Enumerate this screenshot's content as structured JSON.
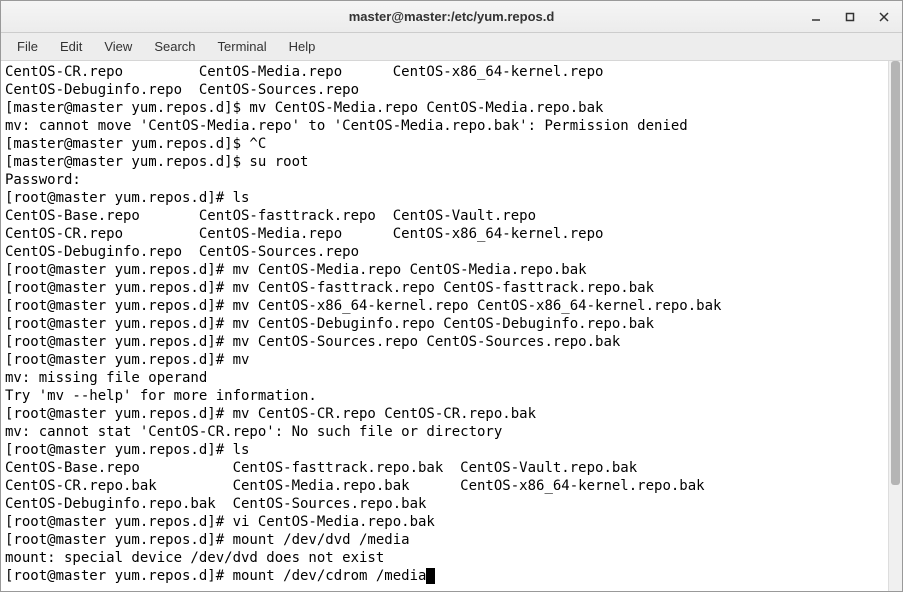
{
  "window": {
    "title": "master@master:/etc/yum.repos.d"
  },
  "menu": {
    "file": "File",
    "edit": "Edit",
    "view": "View",
    "search": "Search",
    "terminal": "Terminal",
    "help": "Help"
  },
  "terminal": {
    "lines": [
      "CentOS-CR.repo         CentOS-Media.repo      CentOS-x86_64-kernel.repo",
      "CentOS-Debuginfo.repo  CentOS-Sources.repo",
      "[master@master yum.repos.d]$ mv CentOS-Media.repo CentOS-Media.repo.bak",
      "mv: cannot move 'CentOS-Media.repo' to 'CentOS-Media.repo.bak': Permission denied",
      "[master@master yum.repos.d]$ ^C",
      "[master@master yum.repos.d]$ su root",
      "Password: ",
      "[root@master yum.repos.d]# ls",
      "CentOS-Base.repo       CentOS-fasttrack.repo  CentOS-Vault.repo",
      "CentOS-CR.repo         CentOS-Media.repo      CentOS-x86_64-kernel.repo",
      "CentOS-Debuginfo.repo  CentOS-Sources.repo",
      "[root@master yum.repos.d]# mv CentOS-Media.repo CentOS-Media.repo.bak",
      "[root@master yum.repos.d]# mv CentOS-fasttrack.repo CentOS-fasttrack.repo.bak",
      "[root@master yum.repos.d]# mv CentOS-x86_64-kernel.repo CentOS-x86_64-kernel.repo.bak",
      "[root@master yum.repos.d]# mv CentOS-Debuginfo.repo CentOS-Debuginfo.repo.bak",
      "[root@master yum.repos.d]# mv CentOS-Sources.repo CentOS-Sources.repo.bak",
      "[root@master yum.repos.d]# mv",
      "mv: missing file operand",
      "Try 'mv --help' for more information.",
      "[root@master yum.repos.d]# mv CentOS-CR.repo CentOS-CR.repo.bak",
      "mv: cannot stat 'CentOS-CR.repo': No such file or directory",
      "[root@master yum.repos.d]# ls",
      "CentOS-Base.repo           CentOS-fasttrack.repo.bak  CentOS-Vault.repo.bak",
      "CentOS-CR.repo.bak         CentOS-Media.repo.bak      CentOS-x86_64-kernel.repo.bak",
      "CentOS-Debuginfo.repo.bak  CentOS-Sources.repo.bak",
      "[root@master yum.repos.d]# vi CentOS-Media.repo.bak",
      "[root@master yum.repos.d]# mount /dev/dvd /media",
      "mount: special device /dev/dvd does not exist",
      "[root@master yum.repos.d]# mount /dev/cdrom /media"
    ]
  }
}
